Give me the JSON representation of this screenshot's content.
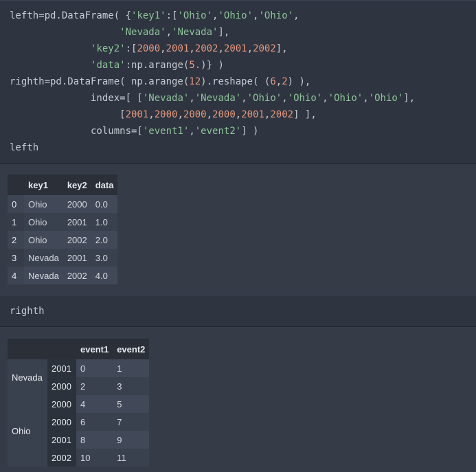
{
  "code_cell_1": {
    "lines": [
      [
        [
          "lefth=pd.DataFrame( {",
          "p"
        ],
        [
          "'key1'",
          "s"
        ],
        [
          ":[",
          "p"
        ],
        [
          "'Ohio'",
          "s"
        ],
        [
          ",",
          "p"
        ],
        [
          "'Ohio'",
          "s"
        ],
        [
          ",",
          "p"
        ],
        [
          "'Ohio'",
          "s"
        ],
        [
          ",",
          "p"
        ]
      ],
      [
        [
          "                   ",
          "p"
        ],
        [
          "'Nevada'",
          "s"
        ],
        [
          ",",
          "p"
        ],
        [
          "'Nevada'",
          "s"
        ],
        [
          "],",
          "p"
        ]
      ],
      [
        [
          "              ",
          "p"
        ],
        [
          "'key2'",
          "s"
        ],
        [
          ":[",
          "p"
        ],
        [
          "2000",
          "n"
        ],
        [
          ",",
          "p"
        ],
        [
          "2001",
          "n"
        ],
        [
          ",",
          "p"
        ],
        [
          "2002",
          "n"
        ],
        [
          ",",
          "p"
        ],
        [
          "2001",
          "n"
        ],
        [
          ",",
          "p"
        ],
        [
          "2002",
          "n"
        ],
        [
          "],",
          "p"
        ]
      ],
      [
        [
          "              ",
          "p"
        ],
        [
          "'data'",
          "s"
        ],
        [
          ":np.arange(",
          "p"
        ],
        [
          "5.",
          "n"
        ],
        [
          ")} )",
          "p"
        ]
      ],
      [
        [
          "righth=pd.DataFrame( np.arange(",
          "p"
        ],
        [
          "12",
          "n"
        ],
        [
          ").reshape( (",
          "p"
        ],
        [
          "6",
          "n"
        ],
        [
          ",",
          "p"
        ],
        [
          "2",
          "n"
        ],
        [
          ") ),",
          "p"
        ]
      ],
      [
        [
          "              index=[ [",
          "p"
        ],
        [
          "'Nevada'",
          "s"
        ],
        [
          ",",
          "p"
        ],
        [
          "'Nevada'",
          "s"
        ],
        [
          ",",
          "p"
        ],
        [
          "'Ohio'",
          "s"
        ],
        [
          ",",
          "p"
        ],
        [
          "'Ohio'",
          "s"
        ],
        [
          ",",
          "p"
        ],
        [
          "'Ohio'",
          "s"
        ],
        [
          ",",
          "p"
        ],
        [
          "'Ohio'",
          "s"
        ],
        [
          "],",
          "p"
        ]
      ],
      [
        [
          "                   [",
          "p"
        ],
        [
          "2001",
          "n"
        ],
        [
          ",",
          "p"
        ],
        [
          "2000",
          "n"
        ],
        [
          ",",
          "p"
        ],
        [
          "2000",
          "n"
        ],
        [
          ",",
          "p"
        ],
        [
          "2000",
          "n"
        ],
        [
          ",",
          "p"
        ],
        [
          "2001",
          "n"
        ],
        [
          ",",
          "p"
        ],
        [
          "2002",
          "n"
        ],
        [
          "] ],",
          "p"
        ]
      ],
      [
        [
          "              columns=[",
          "p"
        ],
        [
          "'event1'",
          "s"
        ],
        [
          ",",
          "p"
        ],
        [
          "'event2'",
          "s"
        ],
        [
          "] )",
          "p"
        ]
      ],
      [
        [
          "lefth",
          "p"
        ]
      ]
    ]
  },
  "table_lefth": {
    "columns": [
      "",
      "key1",
      "key2",
      "data"
    ],
    "rows": [
      [
        "0",
        "Ohio",
        "2000",
        "0.0"
      ],
      [
        "1",
        "Ohio",
        "2001",
        "1.0"
      ],
      [
        "2",
        "Ohio",
        "2002",
        "2.0"
      ],
      [
        "3",
        "Nevada",
        "2001",
        "3.0"
      ],
      [
        "4",
        "Nevada",
        "2002",
        "4.0"
      ]
    ]
  },
  "code_cell_2": {
    "lines": [
      [
        [
          "righth",
          "p"
        ]
      ]
    ]
  },
  "table_righth": {
    "columns": [
      "",
      "",
      "event1",
      "event2"
    ],
    "groups": [
      {
        "label": "Nevada",
        "rows": [
          [
            "2001",
            "0",
            "1"
          ],
          [
            "2000",
            "2",
            "3"
          ]
        ]
      },
      {
        "label": "Ohio",
        "rows": [
          [
            "2000",
            "4",
            "5"
          ],
          [
            "2000",
            "6",
            "7"
          ],
          [
            "2001",
            "8",
            "9"
          ],
          [
            "2002",
            "10",
            "11"
          ]
        ]
      }
    ]
  },
  "colors": {
    "string": "#8fc49a",
    "number": "#e89a7e",
    "plain": "#c8ccd4"
  }
}
